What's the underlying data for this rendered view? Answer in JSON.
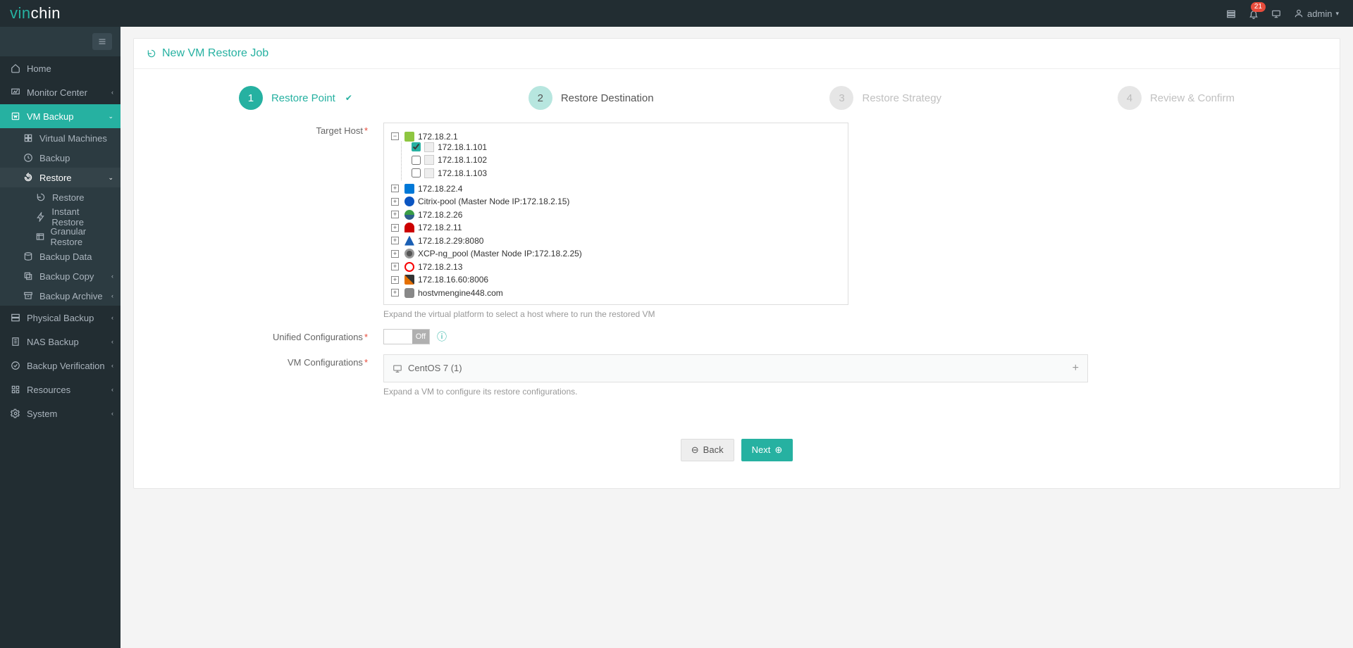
{
  "brand": {
    "pre": "vin",
    "post": "chin"
  },
  "topbar": {
    "notification_count": "21",
    "user": "admin"
  },
  "sidebar": {
    "home": "Home",
    "monitor": "Monitor Center",
    "vmbackup": "VM Backup",
    "virtual_machines": "Virtual Machines",
    "backup": "Backup",
    "restore": "Restore",
    "restore_sub": "Restore",
    "instant_restore": "Instant Restore",
    "granular_restore": "Granular Restore",
    "backup_data": "Backup Data",
    "backup_copy": "Backup Copy",
    "backup_archive": "Backup Archive",
    "physical_backup": "Physical Backup",
    "nas_backup": "NAS Backup",
    "backup_verification": "Backup Verification",
    "resources": "Resources",
    "system": "System"
  },
  "page": {
    "title": "New VM Restore Job"
  },
  "steps": {
    "s1": "Restore Point",
    "s2": "Restore Destination",
    "s3": "Restore Strategy",
    "s4": "Review & Confirm"
  },
  "labels": {
    "target_host": "Target Host",
    "unified_config": "Unified Configurations",
    "vm_config": "VM Configurations"
  },
  "helpers": {
    "target_host": "Expand the virtual platform to select a host where to run the restored VM",
    "vm_config": "Expand a VM to configure its restore configurations."
  },
  "toggle": {
    "off": "Off"
  },
  "tree": {
    "root1": "172.18.2.1",
    "host1": "172.18.1.101",
    "host2": "172.18.1.102",
    "host3": "172.18.1.103",
    "n2": "172.18.22.4",
    "n3": "Citrix-pool (Master Node IP:172.18.2.15)",
    "n4": "172.18.2.26",
    "n5": "172.18.2.11",
    "n6": "172.18.2.29:8080",
    "n7": "XCP-ng_pool (Master Node IP:172.18.2.25)",
    "n8": "172.18.2.13",
    "n9": "172.18.16.60:8006",
    "n10": "hostvmengine448.com"
  },
  "vm_config_row": "CentOS 7 (1)",
  "buttons": {
    "back": "Back",
    "next": "Next"
  }
}
